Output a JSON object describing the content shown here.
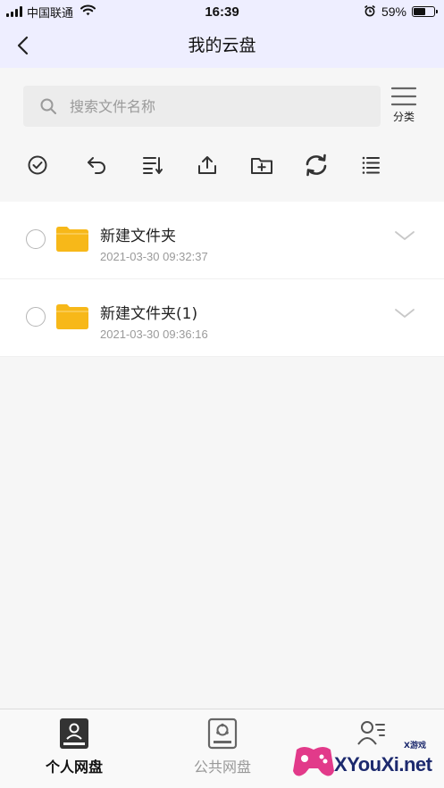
{
  "status_bar": {
    "carrier": "中国联通",
    "time": "16:39",
    "battery": "59%",
    "battery_level": 0.59
  },
  "nav": {
    "title": "我的云盘"
  },
  "search": {
    "placeholder": "搜索文件名称"
  },
  "category": {
    "label": "分类"
  },
  "toolbar": {
    "tools": [
      "check-circle-icon",
      "undo-icon",
      "sort-icon",
      "upload-icon",
      "new-folder-icon",
      "refresh-icon",
      "list-icon"
    ]
  },
  "files": [
    {
      "name": "新建文件夹",
      "time": "2021-03-30 09:32:37"
    },
    {
      "name": "新建文件夹(1)",
      "time": "2021-03-30 09:36:16"
    }
  ],
  "tabs": [
    {
      "label": "个人网盘",
      "icon": "personal-disk-icon",
      "active": true
    },
    {
      "label": "公共网盘",
      "icon": "public-disk-icon",
      "active": false
    },
    {
      "label": "",
      "icon": "contacts-icon",
      "active": false
    }
  ],
  "watermark": {
    "text": "XYouXi.net",
    "small": "X游戏"
  },
  "colors": {
    "header_bg": "#eeeeff",
    "folder": "#f7b819",
    "page_bg": "#f6f6f6"
  }
}
